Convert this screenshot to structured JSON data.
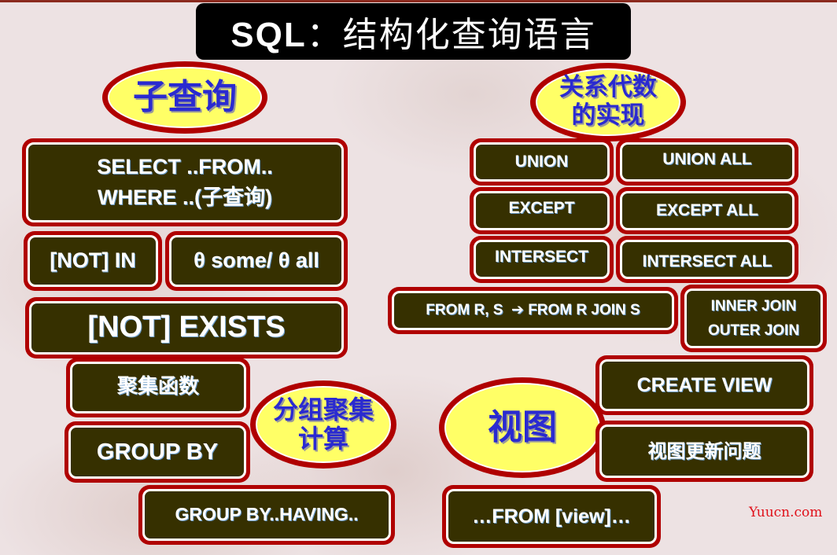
{
  "title": {
    "prefix": "SQL",
    "text": "：结构化查询语言"
  },
  "colors": {
    "box_border": "#b00000",
    "box_fill": "#363000",
    "bubble_fill": "#ffff66",
    "bubble_text": "#2a2ad0"
  },
  "subquery": {
    "bubble": "子查询",
    "select_line1": "SELECT ..FROM..",
    "select_line2": "WHERE ..(子查询)",
    "not_in": "[NOT] IN",
    "some_all": "θ some/ θ all",
    "exists": "[NOT] EXISTS"
  },
  "aggregation": {
    "bubble_line1": "分组聚集",
    "bubble_line2": "计算",
    "agg_func": "聚集函数",
    "group_by": "GROUP BY",
    "group_by_having": "GROUP BY..HAVING.."
  },
  "algebra": {
    "bubble_line1": "关系代数",
    "bubble_line2": "的实现",
    "union": "UNION",
    "union_all": "UNION ALL",
    "except": "EXCEPT",
    "except_all": "EXCEPT ALL",
    "intersect": "INTERSECT",
    "intersect_all": "INTERSECT ALL",
    "from_join": "FROM R, S  ➔ FROM R JOIN S",
    "inner_join": "INNER JOIN",
    "outer_join": "OUTER JOIN"
  },
  "view": {
    "bubble": "视图",
    "create_view": "CREATE VIEW",
    "update_issue": "视图更新问题",
    "from_view": "…FROM [view]…"
  },
  "watermark": "Yuucn.com"
}
